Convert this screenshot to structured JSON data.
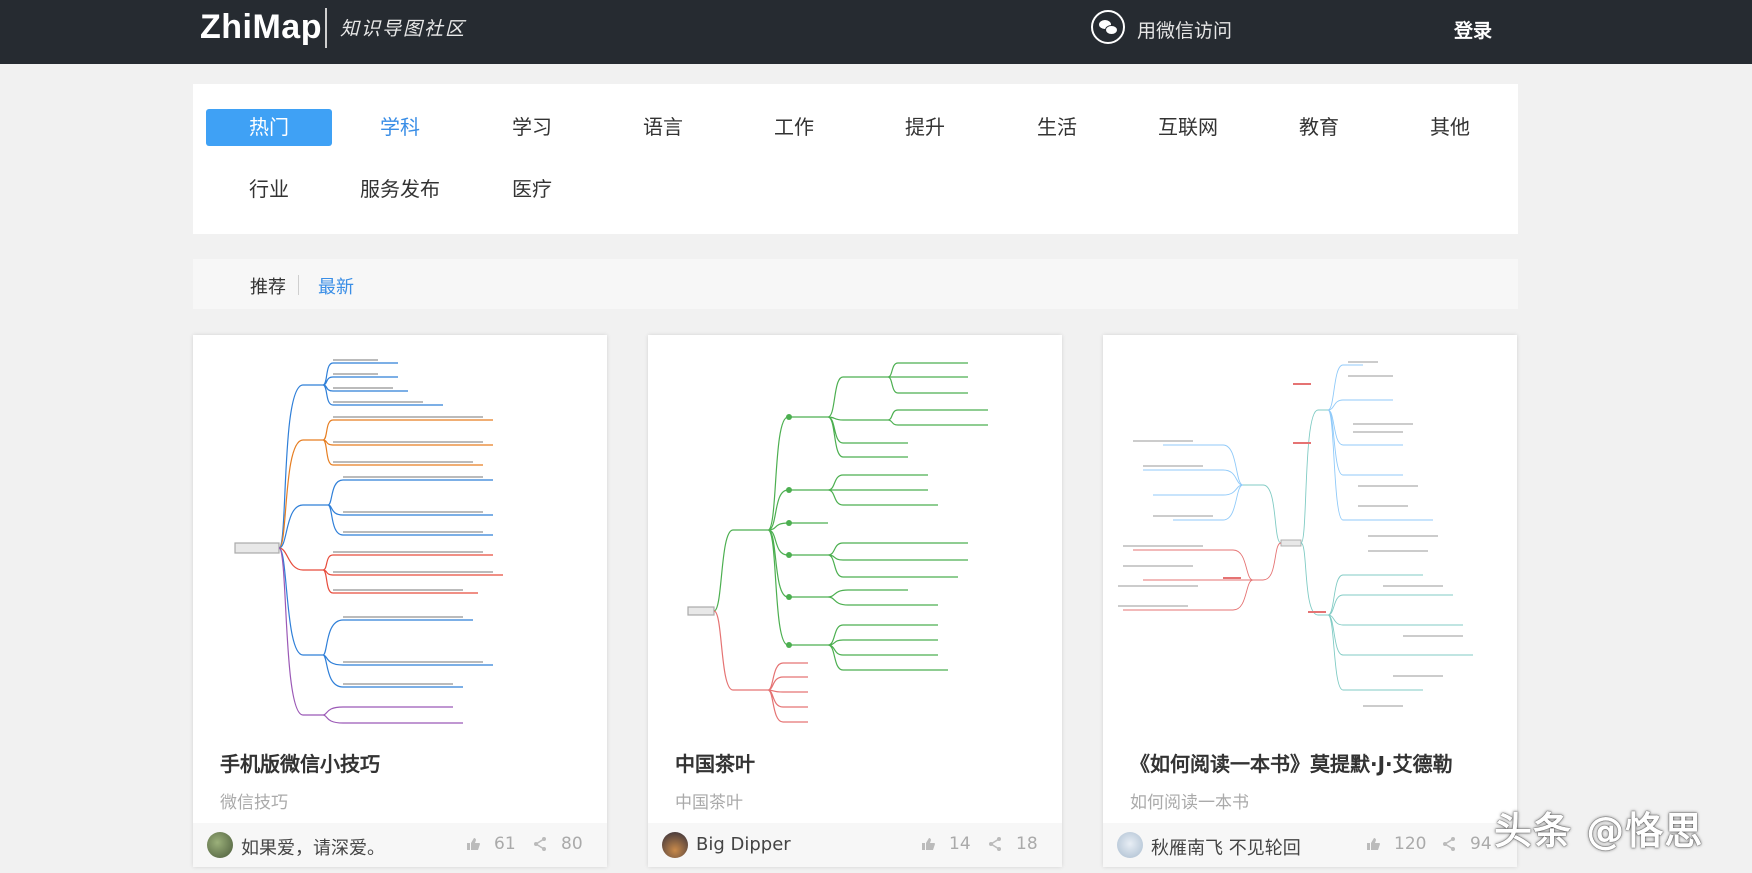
{
  "header": {
    "logo": "ZhiMap",
    "logo_sub": "知识导图社区",
    "wechat_label": "用微信访问",
    "login_label": "登录"
  },
  "categories": [
    "热门",
    "学科",
    "学习",
    "语言",
    "工作",
    "提升",
    "生活",
    "互联网",
    "教育",
    "其他",
    "行业",
    "服务发布",
    "医疗"
  ],
  "filter": {
    "recommend": "推荐",
    "latest": "最新"
  },
  "cards": [
    {
      "title": "手机版微信小技巧",
      "tag": "微信技巧",
      "author": "如果爱，请深爱。",
      "likes": "61",
      "shares": "80"
    },
    {
      "title": "中国茶叶",
      "tag": "中国茶叶",
      "author": "Big Dipper",
      "likes": "14",
      "shares": "18"
    },
    {
      "title": "《如何阅读一本书》莫提默·J·艾德勒",
      "tag": "如何阅读一本书",
      "author": "秋雁南飞 不见轮回",
      "likes": "120",
      "shares": "94"
    }
  ],
  "watermark": "头条 @恪思",
  "colors": {
    "header_bg": "#262b31",
    "accent": "#3fa1f5",
    "link": "#3a8ee6"
  }
}
